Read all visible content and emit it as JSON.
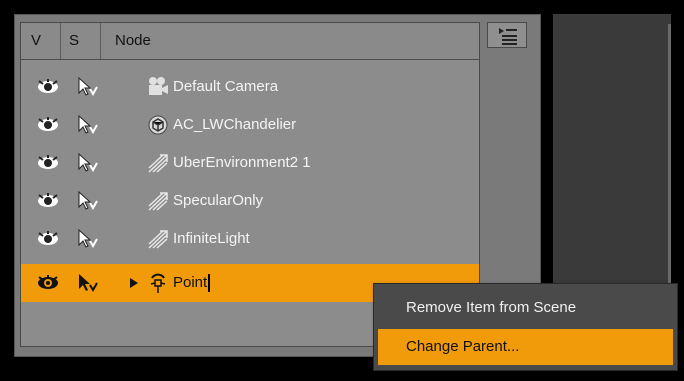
{
  "scene_panel": {
    "columns": {
      "visible": "V",
      "selectable": "S",
      "node": "Node"
    },
    "rows": [
      {
        "label": "Default Camera",
        "icon": "camera-icon",
        "selected": false
      },
      {
        "label": "AC_LWChandelier",
        "icon": "figure-icon",
        "selected": false
      },
      {
        "label": "UberEnvironment2 1",
        "icon": "light-icon",
        "selected": false
      },
      {
        "label": "SpecularOnly",
        "icon": "light-icon",
        "selected": false
      },
      {
        "label": "InfiniteLight",
        "icon": "light-icon",
        "selected": false
      },
      {
        "label": "Point",
        "icon": "point-light-icon",
        "selected": true,
        "editing": true
      }
    ]
  },
  "context_menu": {
    "items": [
      {
        "label": "Remove Item from Scene",
        "highlighted": false
      },
      {
        "label": "Change Parent...",
        "highlighted": true
      }
    ]
  },
  "colors": {
    "selection": "#f19a0a",
    "panel": "#8c8c8c",
    "menu": "#4a4a4a"
  }
}
